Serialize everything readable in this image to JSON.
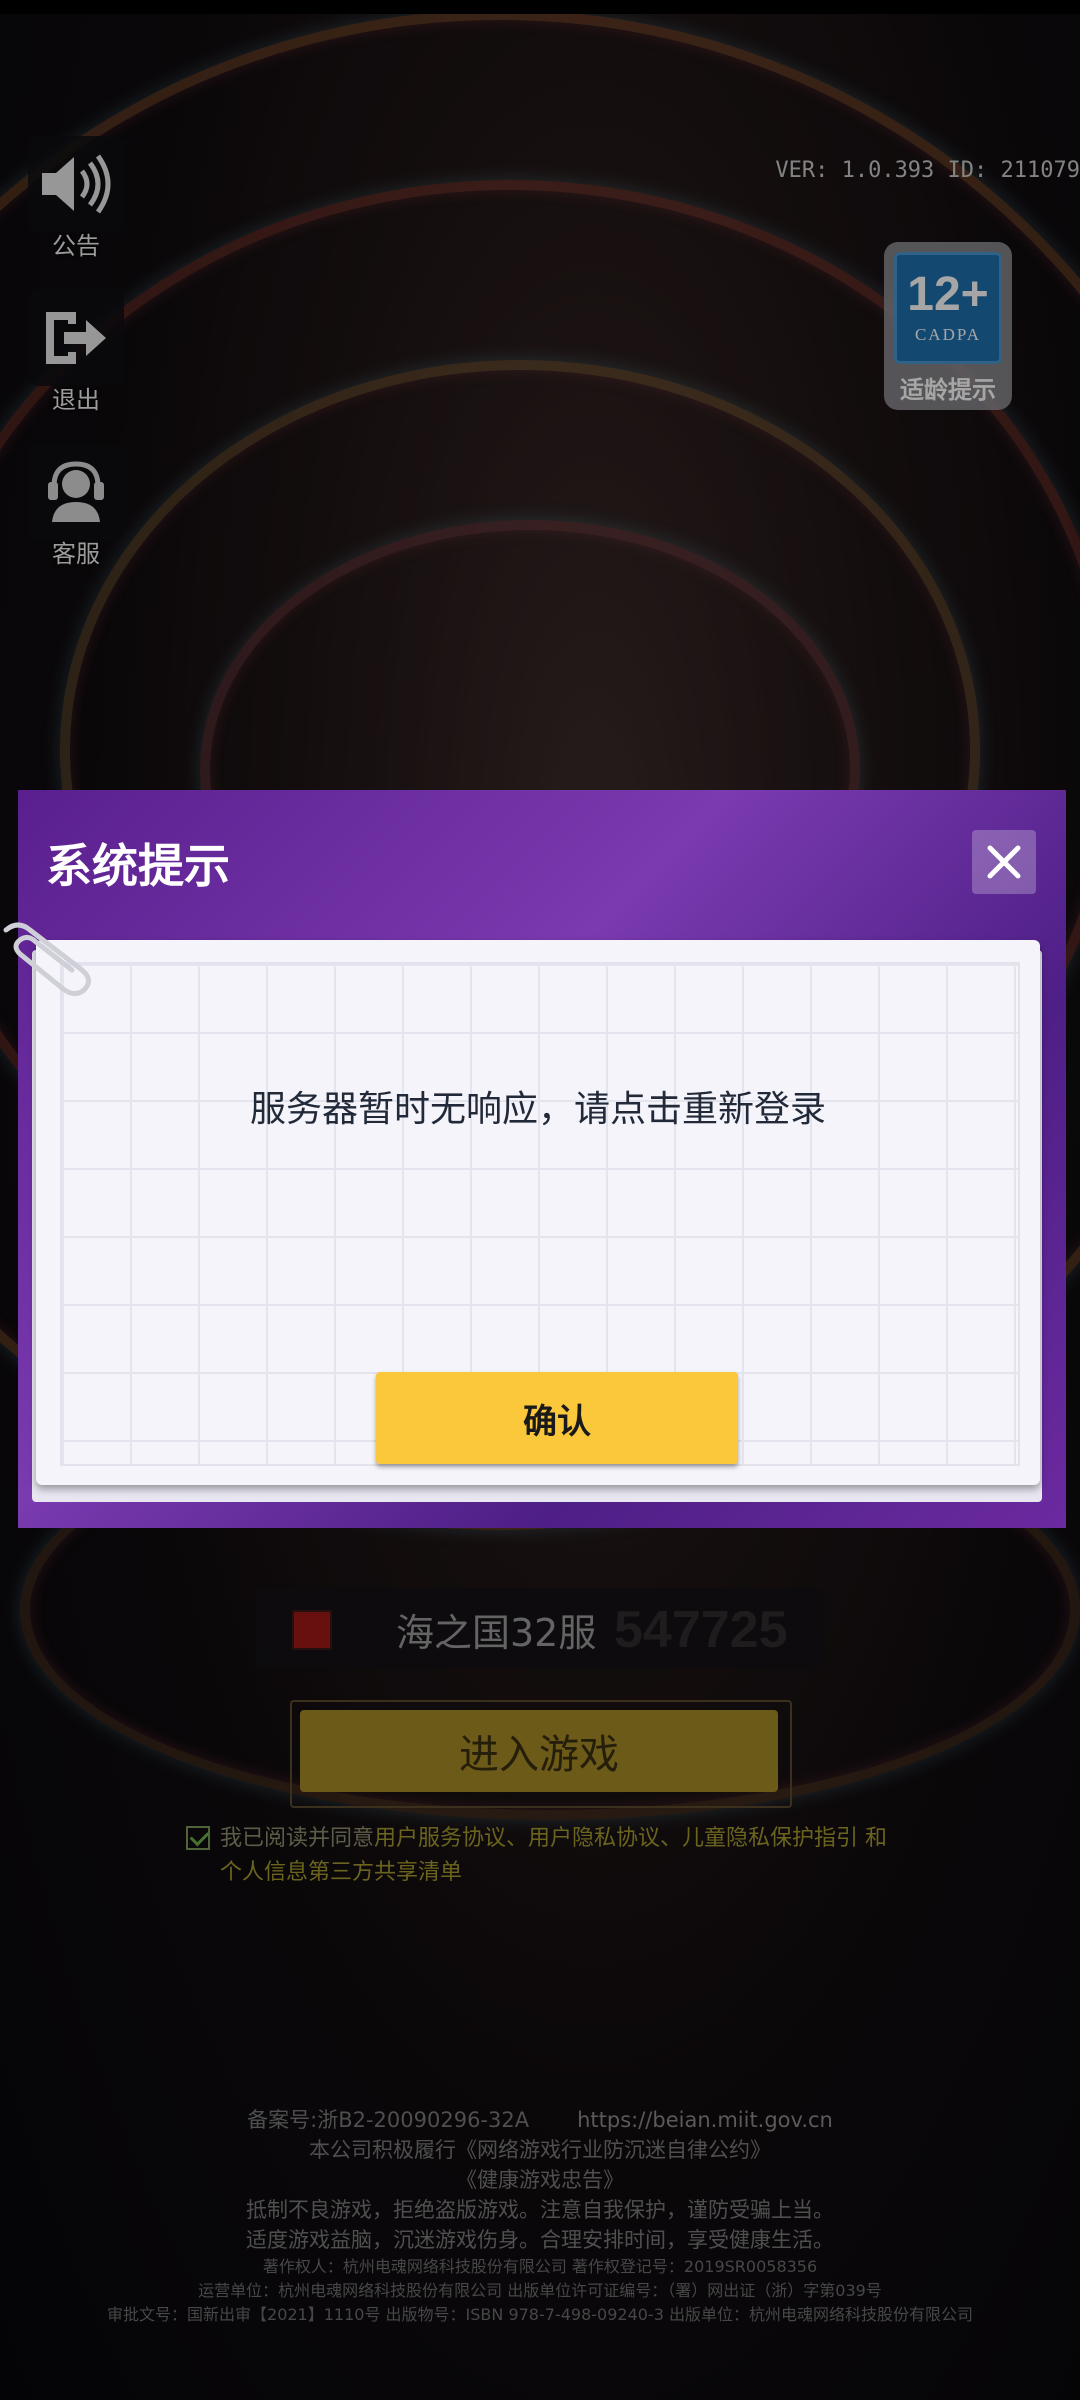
{
  "sidebar": {
    "notice_label": "公告",
    "exit_label": "退出",
    "service_label": "客服"
  },
  "version_text": "VER: 1.0.393  ID: 211079",
  "age_rating": {
    "number": "12+",
    "org": "CADPA",
    "label": "适龄提示"
  },
  "dialog": {
    "title": "系统提示",
    "message": "服务器暂时无响应，请点击重新登录",
    "confirm_label": "确认"
  },
  "server": {
    "name": "海之国32服",
    "id": "547725"
  },
  "enter_label": "进入游戏",
  "agreement": {
    "prefix": "我已阅读并同意",
    "links": "用户服务协议、用户隐私协议、儿童隐私保护指引",
    "conj": " 和",
    "line2": "个人信息第三方共享清单",
    "checked": true
  },
  "footer": {
    "icp": "备案号:浙B2-20090296-32A",
    "icp_url": "https://beian.miit.gov.cn",
    "line1": "本公司积极履行《网络游戏行业防沉迷自律公约》",
    "line2": "《健康游戏忠告》",
    "line3": "抵制不良游戏，拒绝盗版游戏。注意自我保护，谨防受骗上当。",
    "line4": "适度游戏益脑，沉迷游戏伤身。合理安排时间，享受健康生活。",
    "line5": "著作权人：杭州电魂网络科技股份有限公司 著作权登记号：2019SR0058356",
    "line6": "运营单位：杭州电魂网络科技股份有限公司 出版单位许可证编号：（署）网出证（浙）字第039号",
    "line7": "审批文号：国新出审【2021】1110号 出版物号：ISBN 978-7-498-09240-3 出版单位：杭州电魂网络科技股份有限公司"
  }
}
